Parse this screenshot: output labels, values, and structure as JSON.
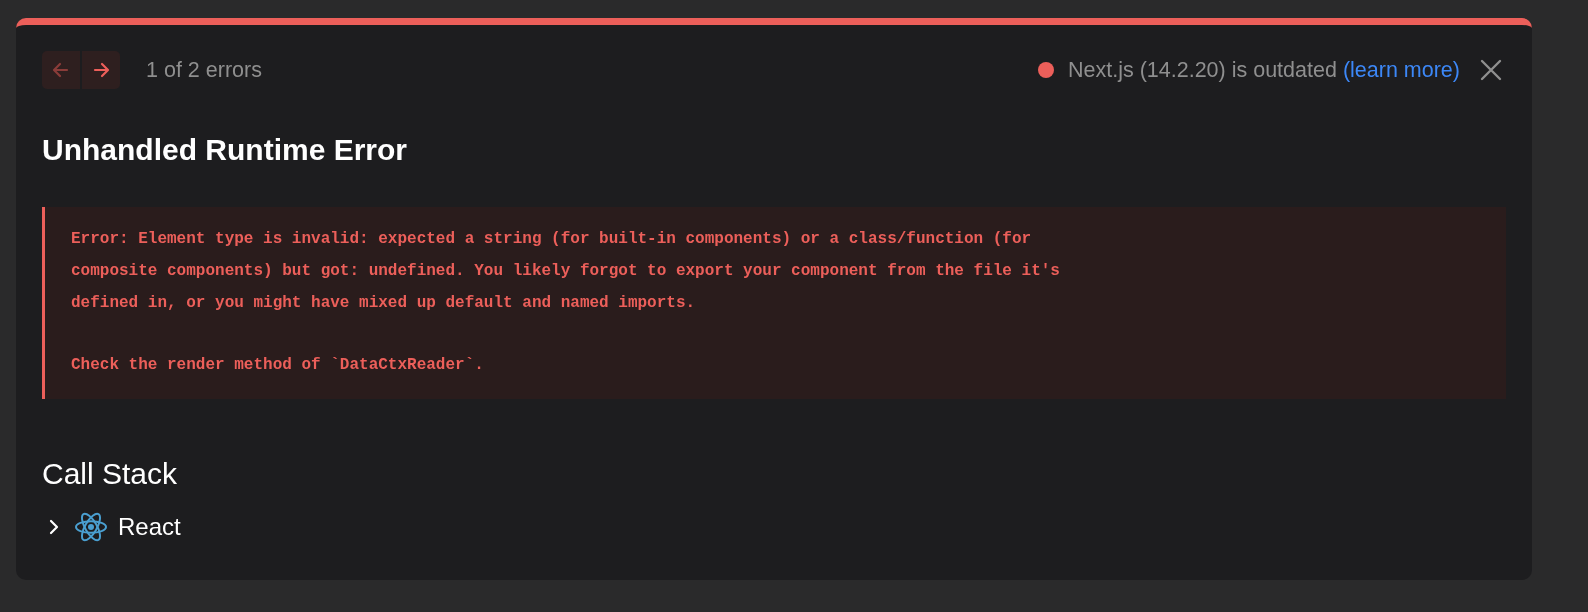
{
  "nav": {
    "prev": {
      "disabled": true
    },
    "next": {
      "disabled": false
    },
    "counter": "1 of 2 errors"
  },
  "version_notice": {
    "text": "Next.js (14.2.20) is outdated",
    "link": "(learn more)"
  },
  "title": "Unhandled Runtime Error",
  "error_message": [
    "Error: Element type is invalid: expected a string (for built-in components) or a class/function (for composite components) but got: undefined. You likely forgot to export your component from the file it's defined in, or you might have mixed up default and named imports.",
    "Check the render method of `DataCtxReader`."
  ],
  "call_stack": {
    "heading": "Call Stack",
    "frames": [
      {
        "label": "React",
        "expanded": false
      }
    ]
  }
}
